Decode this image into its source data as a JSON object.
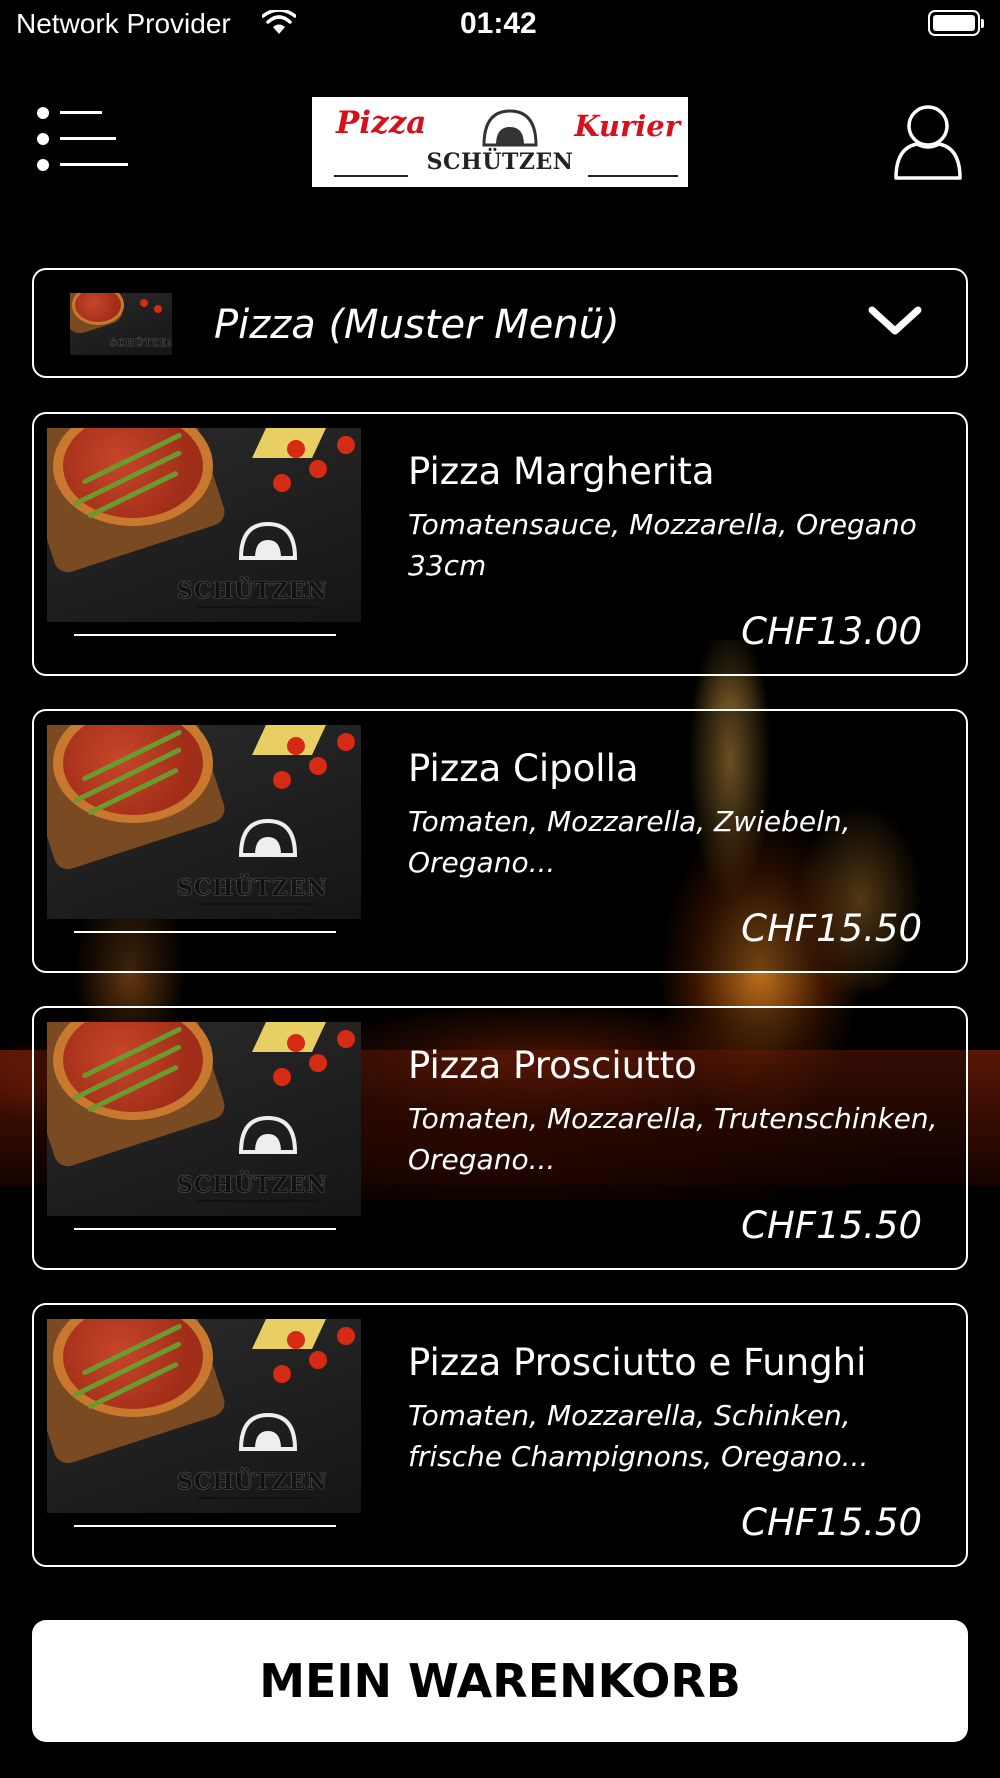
{
  "status_bar": {
    "provider": "Network Provider",
    "time": "01:42",
    "icons": [
      "wifi-icon",
      "battery-icon"
    ]
  },
  "header": {
    "menu_icon": "list-menu-icon",
    "logo": {
      "word_left": "Pizza",
      "word_right": "Kurier",
      "brand": "SCHÜTZEN"
    },
    "profile_icon": "user-profile-icon"
  },
  "category": {
    "selected": "Pizza (Muster Menü)",
    "thumbnail_brand": "SCHÜTZEN",
    "icon": "chevron-down-icon"
  },
  "products": [
    {
      "name": "Pizza Margherita",
      "description": "Tomatensauce, Mozzarella, Oregano 33cm",
      "price": "CHF13.00",
      "image_brand": "SCHÜTZEN"
    },
    {
      "name": "Pizza Cipolla",
      "description": "Tomaten, Mozzarella, Zwiebeln, Oregano...",
      "price": "CHF15.50",
      "image_brand": "SCHÜTZEN"
    },
    {
      "name": "Pizza Prosciutto",
      "description": "Tomaten, Mozzarella, Trutenschinken, Oregano...",
      "price": "CHF15.50",
      "image_brand": "SCHÜTZEN"
    },
    {
      "name": "Pizza Prosciutto e Funghi",
      "description": "Tomaten, Mozzarella, Schinken, frische Champignons, Oregano...",
      "price": "CHF15.50",
      "image_brand": "SCHÜTZEN"
    }
  ],
  "cart_button": {
    "label": "MEIN WARENKORB"
  },
  "colors": {
    "background": "#000000",
    "accent": "#ffffff",
    "logo_red": "#d6111b"
  }
}
